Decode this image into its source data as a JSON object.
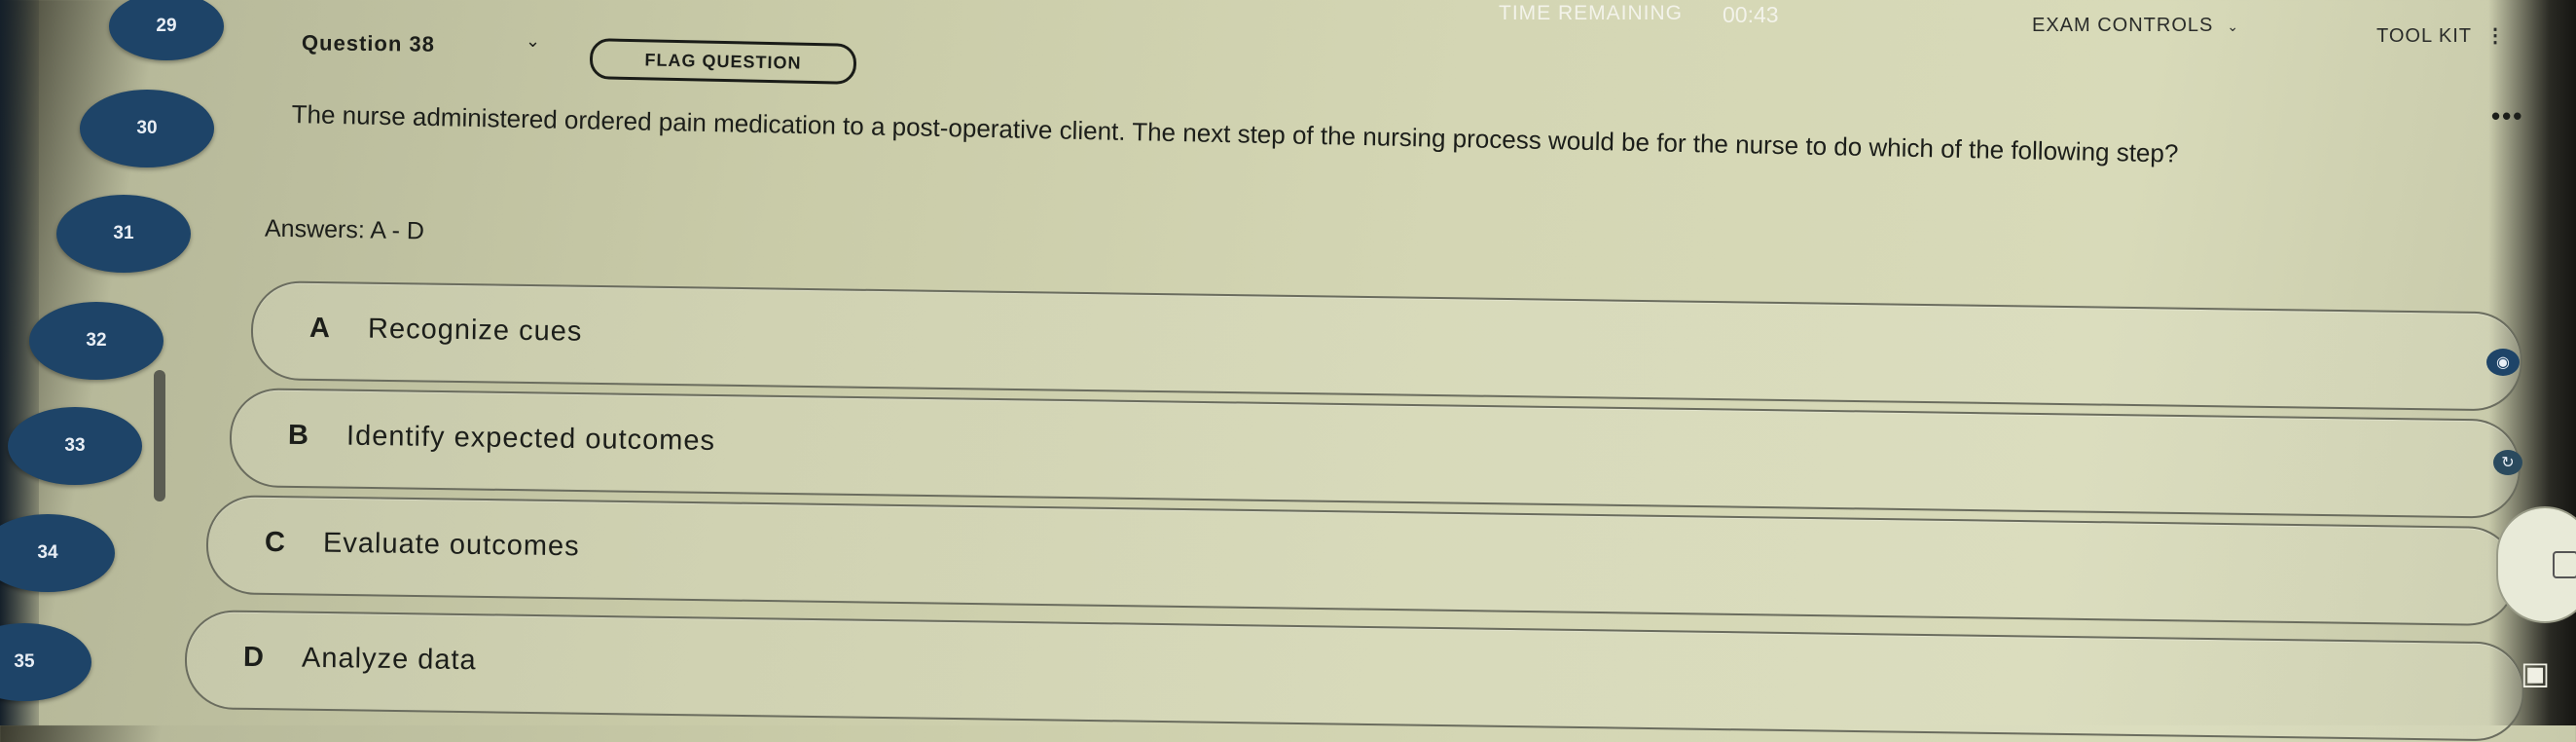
{
  "header": {
    "timer_label": "TIME REMAINING",
    "timer_value": "00:43",
    "exam_controls": "EXAM CONTROLS",
    "tool_kit": "TOOL KIT"
  },
  "question": {
    "title": "Question 38",
    "flag_label": "FLAG QUESTION",
    "stem": "The nurse administered ordered pain medication to a post-operative client. The next step of the nursing process would be for the nurse to do which of the following step?",
    "answers_label": "Answers: A - D",
    "options": [
      {
        "letter": "A",
        "text": "Recognize cues"
      },
      {
        "letter": "B",
        "text": "Identify expected outcomes"
      },
      {
        "letter": "C",
        "text": "Evaluate outcomes"
      },
      {
        "letter": "D",
        "text": "Analyze data"
      }
    ]
  },
  "nav": {
    "numbers": [
      "29",
      "30",
      "31",
      "32",
      "33",
      "34",
      "35"
    ]
  },
  "colors": {
    "nav_circle": "#1e4468",
    "background": "#d4d6b4"
  },
  "icons": {
    "chevron": "chevron-down-icon",
    "more": "more-horizontal-icon",
    "camera": "camera-icon",
    "eye": "eye-icon"
  }
}
